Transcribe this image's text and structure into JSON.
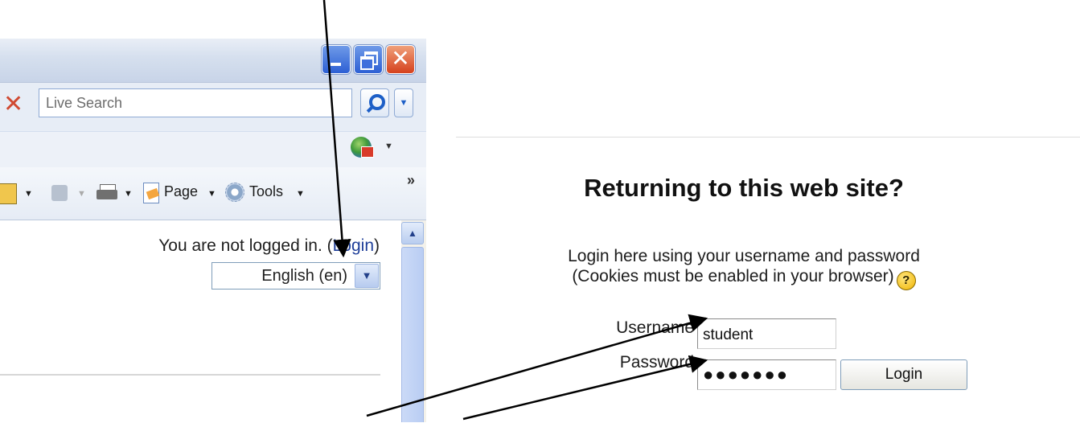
{
  "browser": {
    "search": {
      "placeholder": "Live Search"
    },
    "commandbar": {
      "page_label": "Page",
      "tools_label": "Tools",
      "more_label": "»"
    },
    "content": {
      "status_text": "You are not logged in. (",
      "login_link": "Login",
      "status_close": ")",
      "language": "English (en)"
    }
  },
  "login_panel": {
    "heading": "Returning to this web site?",
    "instructions_line1": "Login here using your username and password",
    "instructions_line2": "(Cookies must be enabled in your browser)",
    "help_glyph": "?",
    "username_label": "Username",
    "username_value": "student",
    "password_label": "Password",
    "password_mask": "●●●●●●●",
    "login_button": "Login"
  },
  "colors": {
    "link": "#1f3f99",
    "window_close": "#d5411d",
    "window_buttons": "#2c5fd4"
  },
  "icons": [
    "minimize-icon",
    "restore-icon",
    "close-icon",
    "stop-icon",
    "search-icon",
    "feeds-icon",
    "home-icon",
    "rss-icon",
    "print-icon",
    "page-icon",
    "tools-icon",
    "help-icon"
  ]
}
